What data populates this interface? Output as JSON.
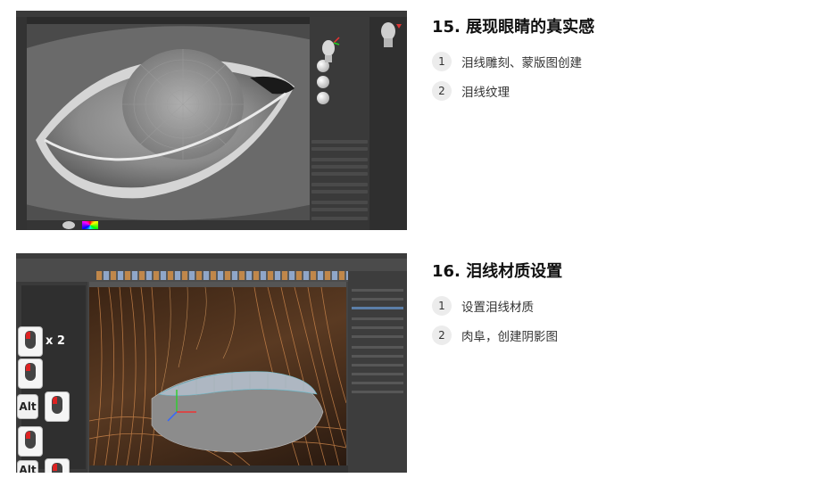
{
  "sections": [
    {
      "title": "15. 展现眼睛的真实感",
      "items": [
        {
          "number": "1",
          "text": "泪线雕刻、蒙版图创建"
        },
        {
          "number": "2",
          "text": "泪线纹理"
        }
      ]
    },
    {
      "title": "16. 泪线材质设置",
      "items": [
        {
          "number": "1",
          "text": "设置泪线材质"
        },
        {
          "number": "2",
          "text": "肉阜，创建阴影图"
        }
      ]
    }
  ],
  "screenshot2": {
    "overlay_keys": {
      "alt_label": "Alt",
      "multiplier": "x 2"
    }
  }
}
